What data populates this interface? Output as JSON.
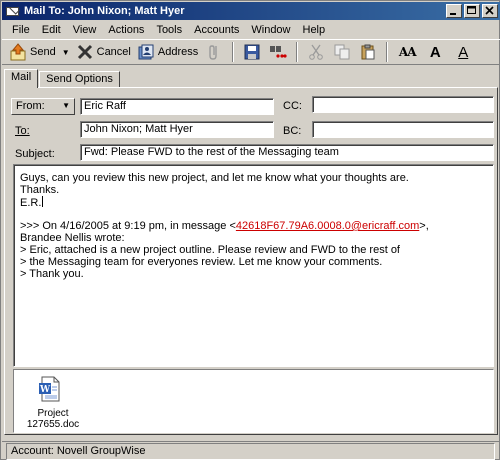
{
  "window": {
    "title": "Mail To: John Nixon; Matt Hyer",
    "buttons": [
      "minimize",
      "maximize",
      "close"
    ]
  },
  "menu": [
    "File",
    "Edit",
    "View",
    "Actions",
    "Tools",
    "Accounts",
    "Window",
    "Help"
  ],
  "toolbar": {
    "send_label": "Send",
    "cancel_label": "Cancel",
    "address_label": "Address",
    "icons": [
      "send-icon",
      "cancel-icon",
      "address-book-icon",
      "attach-icon",
      "save-icon",
      "spell-check-icon",
      "cut-icon",
      "copy-icon",
      "paste-icon",
      "font-size-icon",
      "bold-icon",
      "underline-icon"
    ],
    "font_aa": "AA",
    "font_bold": "A",
    "font_plain": "A"
  },
  "tabs": [
    "Mail",
    "Send Options"
  ],
  "header": {
    "from_label": "From:",
    "from_value": "Eric Raff",
    "cc_label": "CC:",
    "cc_value": "",
    "to_label": "To:",
    "to_value": "John Nixon; Matt Hyer",
    "bc_label": "BC:",
    "bc_value": "",
    "subject_label": "Subject:",
    "subject_value": "Fwd: Please FWD to the rest of the Messaging team"
  },
  "message": {
    "line1": "Guys, can you review this new project, and let me know what your thoughts are.",
    "line2": "Thanks.",
    "line3": "E.R.",
    "quote_prefix": ">>> On 4/16/2005 at 9:19 pm, in message <",
    "quote_link": "42618F67.79A6.0008.0@ericraff.com",
    "quote_suffix": ">,",
    "quote_author": "Brandee Nellis wrote:",
    "quote1": "> Eric, attached is a new project outline. Please review and FWD to the rest of",
    "quote2": "> the Messaging team for everyones review. Let me know your comments.",
    "quote3": "> Thank you."
  },
  "attachment": {
    "name_line1": "Project",
    "name_line2": "127655.doc",
    "icon": "word-document-icon"
  },
  "status": {
    "text": "Account: Novell GroupWise"
  },
  "colors": {
    "titlebar_start": "#0a246a",
    "titlebar_end": "#3a6ea5",
    "link": "#cc0000",
    "face": "#d4d0c8"
  }
}
